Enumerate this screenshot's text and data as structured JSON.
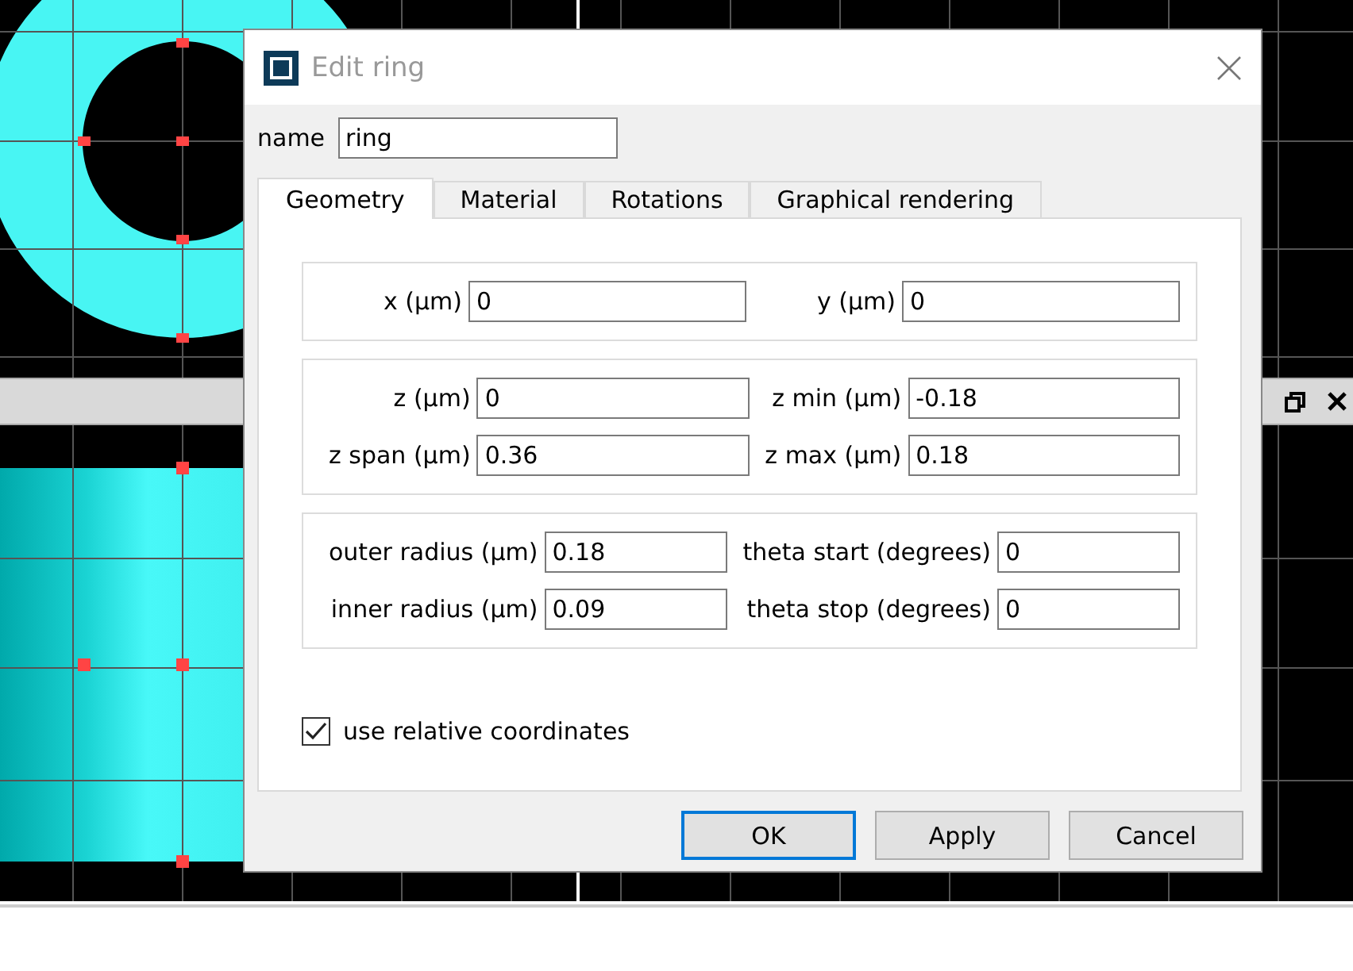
{
  "dialog": {
    "title": "Edit ring",
    "name_label": "name",
    "name_value": "ring",
    "tabs": [
      {
        "label": "Geometry",
        "selected": true
      },
      {
        "label": "Material",
        "selected": false
      },
      {
        "label": "Rotations",
        "selected": false
      },
      {
        "label": "Graphical rendering",
        "selected": false
      }
    ],
    "groups": [
      {
        "fields": [
          {
            "label": "x (µm)",
            "value": "0"
          },
          {
            "label": "y (µm)",
            "value": "0"
          }
        ]
      },
      {
        "fields": [
          {
            "label": "z (µm)",
            "value": "0"
          },
          {
            "label": "z min (µm)",
            "value": "-0.18"
          },
          {
            "label": "z span (µm)",
            "value": "0.36"
          },
          {
            "label": "z max (µm)",
            "value": "0.18"
          }
        ]
      },
      {
        "fields": [
          {
            "label": "outer radius (µm)",
            "value": "0.18"
          },
          {
            "label": "theta start (degrees)",
            "value": "0"
          },
          {
            "label": "inner radius (µm)",
            "value": "0.09"
          },
          {
            "label": "theta stop (degrees)",
            "value": "0"
          }
        ]
      }
    ],
    "checkbox": {
      "label": "use relative coordinates",
      "checked": true
    },
    "buttons": [
      {
        "label": "OK",
        "default": true
      },
      {
        "label": "Apply",
        "default": false
      },
      {
        "label": "Cancel",
        "default": false
      }
    ]
  }
}
